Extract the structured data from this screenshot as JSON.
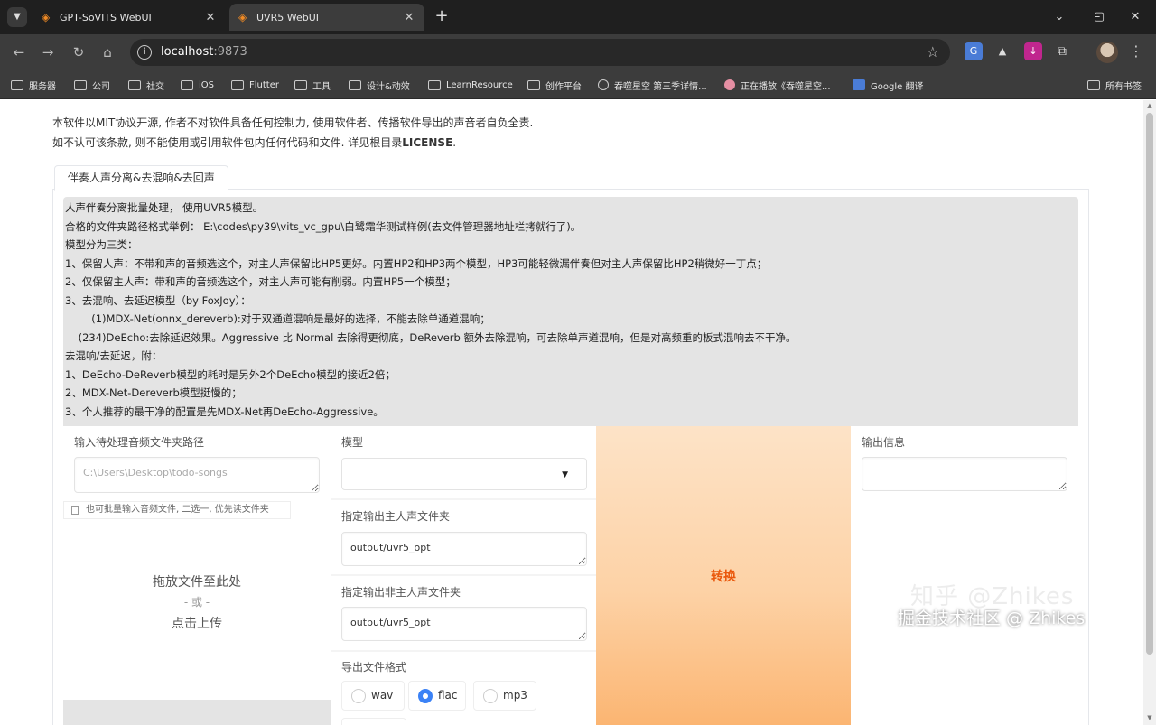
{
  "browser": {
    "tabs": [
      {
        "title": "GPT-SoVITS WebUI",
        "active": false
      },
      {
        "title": "UVR5 WebUI",
        "active": true
      }
    ],
    "url_host": "localhost",
    "url_port": ":9873",
    "bookmarks": [
      "服务器",
      "公司",
      "社交",
      "iOS",
      "Flutter",
      "工具",
      "设计&动效",
      "LearnResource",
      "创作平台",
      "吞噬星空 第三季详情...",
      "正在播放《吞噬星空...",
      "Google 翻译"
    ],
    "all_bookmarks": "所有书签",
    "icons": {
      "tab_list": "chevron-down-icon",
      "new_tab": "plus-icon",
      "back": "arrow-left-icon",
      "forward": "arrow-right-icon",
      "reload": "reload-icon",
      "home": "home-icon",
      "site_info": "info-icon",
      "bookmark": "star-icon",
      "extensions": "puzzle-icon",
      "menu": "kebab-menu-icon"
    }
  },
  "page": {
    "notice_line1": "本软件以MIT协议开源, 作者不对软件具备任何控制力, 使用软件者、传播软件导出的声音者自负全责.",
    "notice_line2_prefix": "如不认可该条款, 则不能使用或引用软件包内任何代码和文件. 详见根目录",
    "notice_line2_bold": "LICENSE",
    "notice_line2_suffix": ".",
    "tab_label": "伴奏人声分离&去混响&去回声",
    "description": [
      "人声伴奏分离批量处理， 使用UVR5模型。",
      "合格的文件夹路径格式举例： E:\\codes\\py39\\vits_vc_gpu\\白鹭霜华测试样例(去文件管理器地址栏拷就行了)。",
      "模型分为三类：",
      "1、保留人声：不带和声的音频选这个，对主人声保留比HP5更好。内置HP2和HP3两个模型，HP3可能轻微漏伴奏但对主人声保留比HP2稍微好一丁点；",
      "2、仅保留主人声：带和声的音频选这个，对主人声可能有削弱。内置HP5一个模型；",
      "3、去混响、去延迟模型（by FoxJoy）：",
      "        (1)MDX-Net(onnx_dereverb):对于双通道混响是最好的选择，不能去除单通道混响；",
      "    (234)DeEcho:去除延迟效果。Aggressive 比 Normal 去除得更彻底，DeReverb 额外去除混响，可去除单声道混响，但是对高频重的板式混响去不干净。",
      "去混响/去延迟，附：",
      "1、DeEcho-DeReverb模型的耗时是另外2个DeEcho模型的接近2倍；",
      "2、MDX-Net-Dereverb模型挺慢的；",
      "3、个人推荐的最干净的配置是先MDX-Net再DeEcho-Aggressive。"
    ],
    "input_dir": {
      "label": "输入待处理音频文件夹路径",
      "placeholder": "C:\\Users\\Desktop\\todo-songs",
      "value": ""
    },
    "batch_hint": "也可批量输入音频文件, 二选一, 优先读文件夹",
    "upload": {
      "line1": "拖放文件至此处",
      "line2": "- 或 -",
      "line3": "点击上传"
    },
    "model": {
      "label": "模型",
      "value": ""
    },
    "vocal_out": {
      "label": "指定输出主人声文件夹",
      "value": "output/uvr5_opt"
    },
    "ins_out": {
      "label": "指定输出非主人声文件夹",
      "value": "output/uvr5_opt"
    },
    "format": {
      "label": "导出文件格式",
      "options": [
        "wav",
        "flac",
        "mp3"
      ],
      "selected": "flac"
    },
    "convert_label": "转换",
    "output_info": {
      "label": "输出信息",
      "value": ""
    },
    "watermark_top": "知乎 @Zhikes",
    "watermark_bottom": "掘金技术社区 @ Zhikes",
    "accent_color": "#ea580c",
    "radio_color": "#3b82f6"
  }
}
